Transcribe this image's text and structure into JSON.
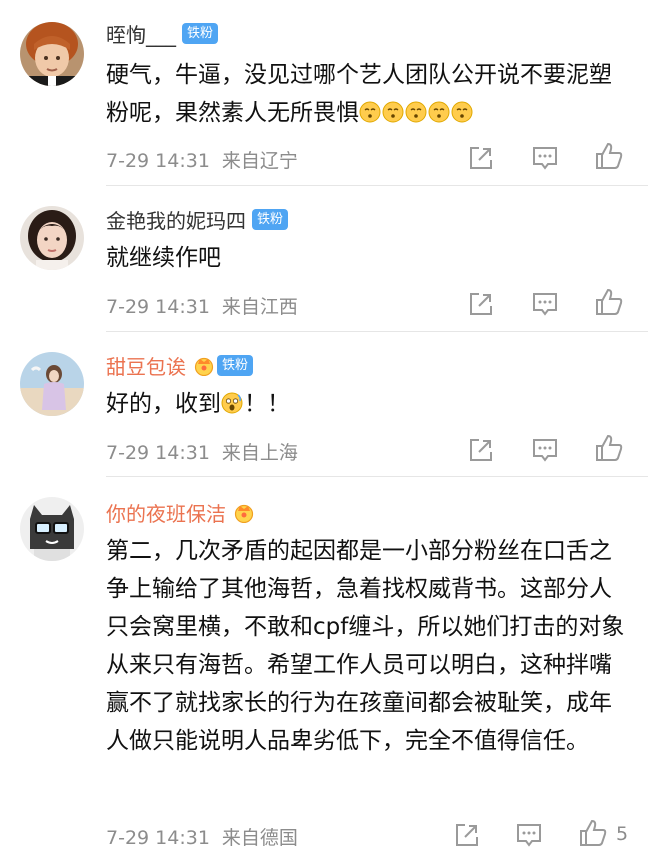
{
  "comments": [
    {
      "username": "晊恂___",
      "badge": "铁粉",
      "vip": false,
      "text": "硬气，牛逼，没见过哪个艺人团队公开说不要泥塑粉呢，果然素人无所畏惧",
      "emojis": [
        "hush-emoji",
        "hush-emoji",
        "hush-emoji",
        "hush-emoji",
        "hush-emoji"
      ],
      "time": "7-29 14:31",
      "location": "来自辽宁",
      "likes": ""
    },
    {
      "username": "金艳我的妮玛四",
      "badge": "铁粉",
      "vip": false,
      "text": "就继续作吧",
      "emojis": [],
      "time": "7-29 14:31",
      "location": "来自江西",
      "likes": ""
    },
    {
      "username": "甜豆包诶",
      "badge": "铁粉",
      "vip": true,
      "text": "好的，收到",
      "text_after_emoji": "！！",
      "emojis": [
        "shocked-emoji"
      ],
      "time": "7-29 14:31",
      "location": "来自上海",
      "likes": ""
    },
    {
      "username": "你的夜班保洁",
      "badge": "",
      "vip": true,
      "text": "第二，几次矛盾的起因都是一小部分粉丝在口舌之争上输给了其他海哲，急着找权威背书。这部分人只会窝里横，不敢和cpf缠斗，所以她们打击的对象从来只有海哲。希望工作人员可以明白，这种拌嘴赢不了就找家长的行为在孩童间都会被耻笑，成年人做只能说明人品卑劣低下，完全不值得信任。",
      "emojis": [],
      "time": "7-29 14:31",
      "location": "来自德国",
      "likes": "5"
    }
  ],
  "colors": {
    "badge": "#4fa5f3",
    "vip_name": "#eb7350",
    "meta": "#8c8c8c",
    "divider": "#e6e6e6"
  },
  "icons": [
    "share-icon",
    "comment-icon",
    "like-icon",
    "crown-icon"
  ]
}
